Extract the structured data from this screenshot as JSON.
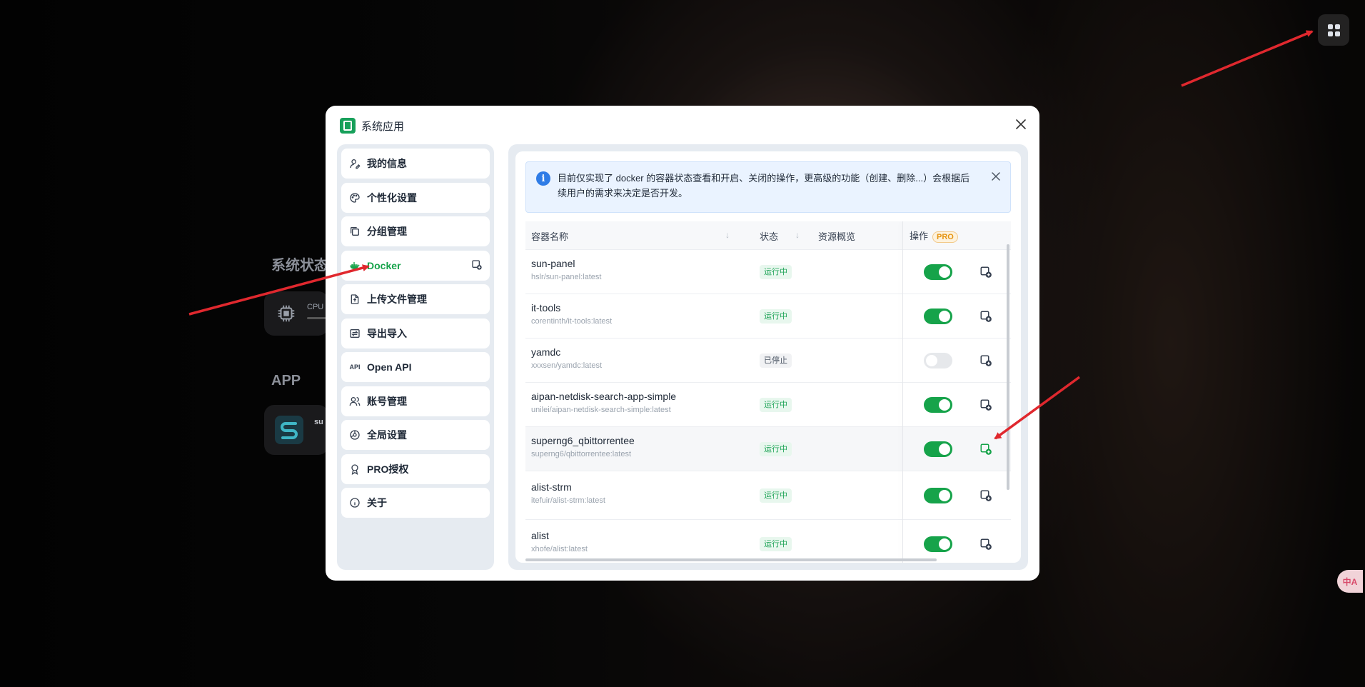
{
  "background": {
    "system_status_title": "系统状态",
    "cpu_label": "CPU",
    "app_section_title": "APP",
    "app_card_text": "su"
  },
  "topbar": {
    "apps_button_icon": "grid-icon"
  },
  "translate_widget": {
    "label": "中A"
  },
  "modal": {
    "title": "系统应用",
    "close_icon": "close-icon"
  },
  "sidebar": {
    "items": [
      {
        "label": "我的信息",
        "icon": "user-edit-icon"
      },
      {
        "label": "个性化设置",
        "icon": "palette-icon"
      },
      {
        "label": "分组管理",
        "icon": "layers-icon"
      },
      {
        "label": "Docker",
        "icon": "docker-icon",
        "active": true
      },
      {
        "label": "上传文件管理",
        "icon": "file-upload-icon"
      },
      {
        "label": "导出导入",
        "icon": "transfer-icon"
      },
      {
        "label": "Open API",
        "icon": "api-icon"
      },
      {
        "label": "账号管理",
        "icon": "users-icon"
      },
      {
        "label": "全局设置",
        "icon": "settings-icon"
      },
      {
        "label": "PRO授权",
        "icon": "award-icon"
      },
      {
        "label": "关于",
        "icon": "info-icon"
      }
    ]
  },
  "alert": {
    "text": "目前仅实现了 docker 的容器状态查看和开启、关闭的操作，更高级的功能（创建、删除...）会根据后续用户的需求来决定是否开发。"
  },
  "table": {
    "columns": {
      "name": "容器名称",
      "status": "状态",
      "resources": "资源概览",
      "actions": "操作",
      "pro_badge": "PRO"
    },
    "rows": [
      {
        "name": "sun-panel",
        "image": "hslr/sun-panel:latest",
        "status": "运行中",
        "running": true
      },
      {
        "name": "it-tools",
        "image": "corentinth/it-tools:latest",
        "status": "运行中",
        "running": true
      },
      {
        "name": "yamdc",
        "image": "xxxsen/yamdc:latest",
        "status": "已停止",
        "running": false
      },
      {
        "name": "aipan-netdisk-search-app-simple",
        "image": "unilei/aipan-netdisk-search-simple:latest",
        "status": "运行中",
        "running": true
      },
      {
        "name": "superng6_qbittorrentee",
        "image": "superng6/qbittorrentee:latest",
        "status": "运行中",
        "running": true,
        "highlighted": true
      },
      {
        "name": "alist-strm",
        "image": "itefuir/alist-strm:latest",
        "status": "运行中",
        "running": true
      },
      {
        "name": "alist",
        "image": "xhofe/alist:latest",
        "status": "运行中",
        "running": true
      }
    ]
  },
  "colors": {
    "accent": "#16a34a",
    "info": "#2f7ce6",
    "pro": "#e59412",
    "annotation_arrow": "#e0282e"
  }
}
